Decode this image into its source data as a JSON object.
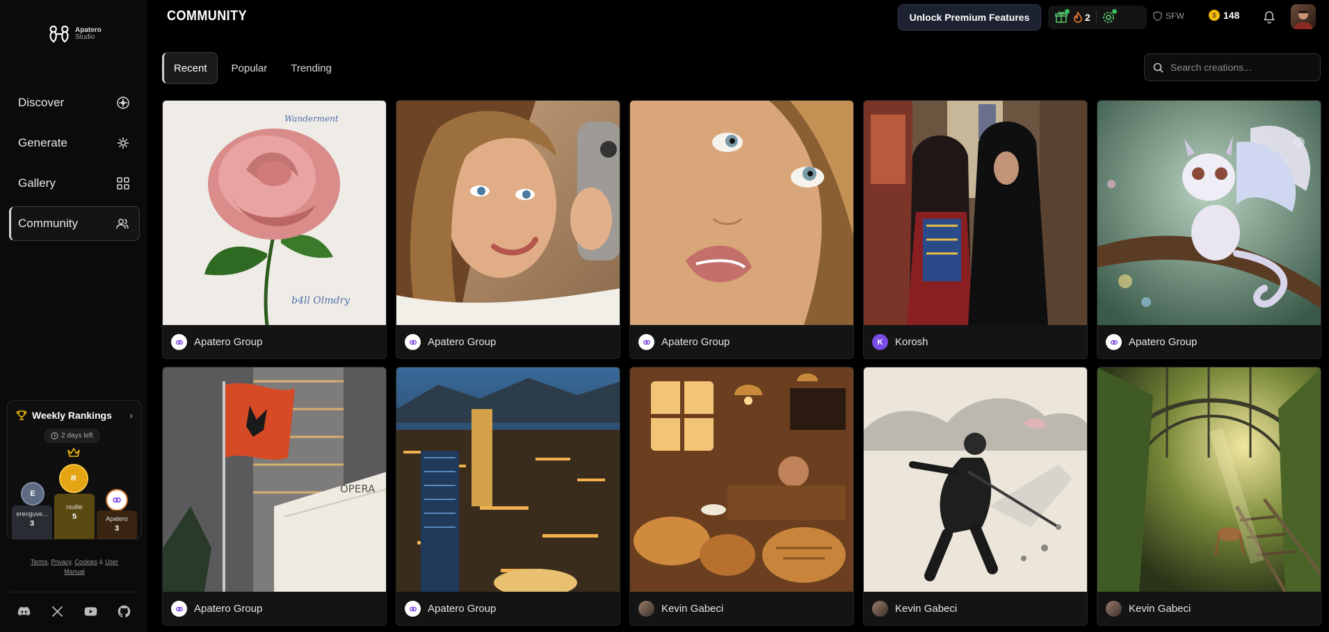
{
  "brand": {
    "name": "Apatero",
    "sub": "Studio"
  },
  "sidebar": {
    "nav": [
      {
        "label": "Discover",
        "icon": "compass-icon"
      },
      {
        "label": "Generate",
        "icon": "sparkle-icon"
      },
      {
        "label": "Gallery",
        "icon": "grid-icon"
      },
      {
        "label": "Community",
        "icon": "users-icon",
        "active": true
      }
    ],
    "rankings": {
      "title": "Weekly Rankings",
      "days_left": "2 days left",
      "first": {
        "initial": "R",
        "name": "rsullie",
        "score": "5"
      },
      "second": {
        "initial": "E",
        "name": "erenguve...",
        "score": "3"
      },
      "third": {
        "initial": "",
        "name": "Apatero",
        "score": "3"
      }
    },
    "legal": {
      "terms": "Terms",
      "privacy": "Privacy",
      "cookies": "Cookies",
      "amp": "&",
      "manual": "User Manual"
    },
    "socials": [
      "discord-icon",
      "x-icon",
      "youtube-icon",
      "github-icon"
    ]
  },
  "header": {
    "title": "COMMUNITY",
    "premium_label": "Unlock Premium Features",
    "streak": "2",
    "sfw_label": "SFW",
    "credits": "148"
  },
  "tabs": [
    {
      "label": "Recent",
      "active": true
    },
    {
      "label": "Popular"
    },
    {
      "label": "Trending"
    }
  ],
  "search": {
    "placeholder": "Search creations..."
  },
  "cards": [
    {
      "author": "Apatero Group",
      "avatar": "apatero",
      "subject": "pink rose"
    },
    {
      "author": "Apatero Group",
      "avatar": "apatero",
      "subject": "selfie portrait"
    },
    {
      "author": "Apatero Group",
      "avatar": "apatero",
      "subject": "face close-up"
    },
    {
      "author": "Korosh",
      "avatar": "korosh",
      "initial": "K",
      "subject": "market women"
    },
    {
      "author": "Apatero Group",
      "avatar": "apatero",
      "subject": "baby dragon"
    },
    {
      "author": "Apatero Group",
      "avatar": "apatero",
      "subject": "flag and opera building"
    },
    {
      "author": "Apatero Group",
      "avatar": "apatero",
      "subject": "city at night"
    },
    {
      "author": "Kevin Gabeci",
      "avatar": "kevin",
      "subject": "bread bakery"
    },
    {
      "author": "Kevin Gabeci",
      "avatar": "kevin",
      "subject": "ink samurai"
    },
    {
      "author": "Kevin Gabeci",
      "avatar": "kevin",
      "subject": "overgrown station"
    }
  ]
}
